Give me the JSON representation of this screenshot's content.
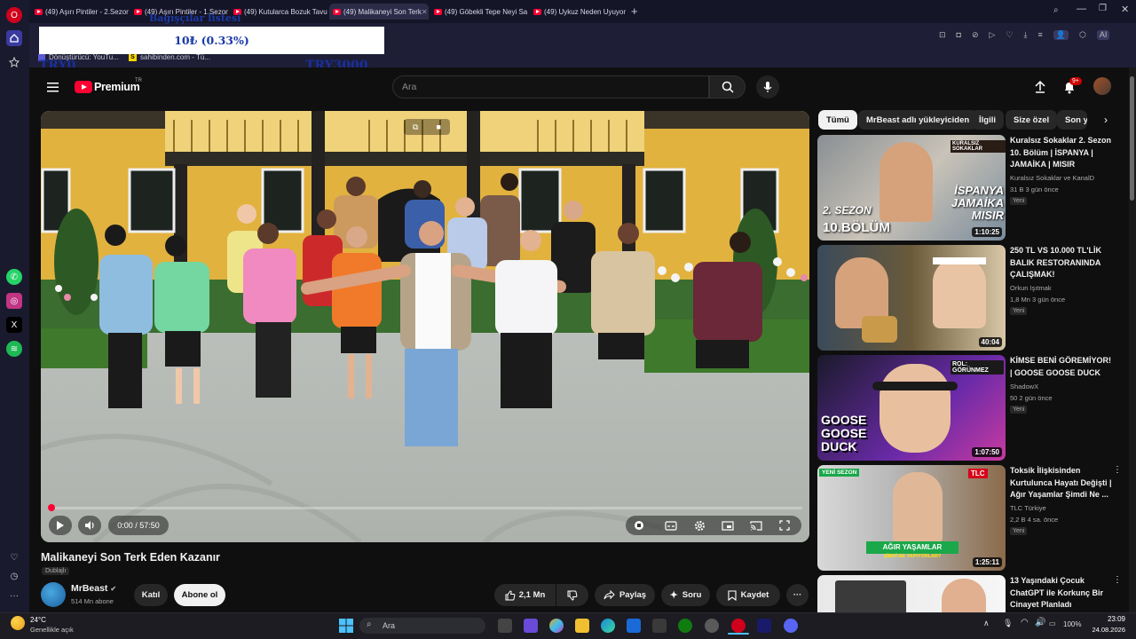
{
  "browser": {
    "tabs": [
      {
        "label": "(49) Aşırı Pintiler - 2.Sezon"
      },
      {
        "label": "(49) Aşırı Pintiler - 1.Sezon"
      },
      {
        "label": "(49) Kutularca Bozuk Tavuk"
      },
      {
        "label": "(49) Malikaneyi Son Terk"
      },
      {
        "label": "(49) Göbekli Tepe Neyi Sa"
      },
      {
        "label": "(49) Uykuz Neden Uyuyor"
      }
    ],
    "bookmarks": [
      {
        "label": "Dönüştürücü: YouTu..."
      },
      {
        "label": "sahibinden.com - Tü..."
      }
    ],
    "overlay": {
      "price": "10₺ (0.33%)",
      "top_text": "Bağışçılar listesi",
      "left_label": "TRY0",
      "right_label": "TRY3000"
    }
  },
  "youtube": {
    "logo": "Premium",
    "logo_sup": "TR",
    "search_placeholder": "Ara",
    "notif_count": "9+",
    "player": {
      "time": "0:00 / 57:50",
      "progress": 0.0
    },
    "video": {
      "title": "Malikaneyi Son Terk Eden Kazanır",
      "dub_label": "Dublajlı",
      "channel": "MrBeast",
      "subs": "514 Mn abone",
      "join": "Katıl",
      "subscribe": "Abone ol",
      "likes": "2,1 Mn",
      "share": "Paylaş",
      "ask": "Soru",
      "save": "Kaydet"
    },
    "chips": [
      "Tümü",
      "MrBeast adlı yükleyiciden",
      "İlgili",
      "Size özel",
      "Son y"
    ],
    "related": [
      {
        "title": "Kuralsız Sokaklar 2. Sezon 10. Bölüm | İSPANYA | JAMAİKA | MISIR",
        "channel": "Kuralsız Sokaklar ve KanalD",
        "meta": "31 B  3 gün önce",
        "badge": "Yeni",
        "duration": "1:10:25",
        "thumb_text1": "2. SEZON",
        "thumb_text2": "10.BÖLÜM",
        "thumb_text3": "İSPANYA JAMAİKA MISIR",
        "thumb_text4": "KURALSIZ SOKAKLAR"
      },
      {
        "title": "250 TL VS 10.000 TL'LİK BALIK RESTORANINDA ÇALIŞMAK!",
        "channel": "Orkun Işıtmak",
        "meta": "1,8 Mn  3 gün önce",
        "badge": "Yeni",
        "duration": "40:04"
      },
      {
        "title": "KİMSE BENİ GÖREMİYOR! | GOOSE GOOSE DUCK",
        "channel": "ShadowX",
        "meta": "50  2 gün önce",
        "badge": "Yeni",
        "duration": "1:07:50",
        "thumb_text1": "GOOSE GOOSE DUCK",
        "thumb_text2": "ROL: GÖRÜNMEZ"
      },
      {
        "title": "Toksik İlişkisinden Kurtulunca Hayatı Değişti | Ağır Yaşamlar Şimdi Ne ...",
        "channel": "TLC Türkiye",
        "meta": "2,2 B  4 sa. önce",
        "badge": "Yeni",
        "duration": "1:25:11",
        "thumb_text1": "YENİ SEZON",
        "thumb_text2": "AĞIR YAŞAMLAR",
        "thumb_text3": "ŞİMDİ NE YAPIYORLAR?",
        "thumb_text4": "TLC"
      },
      {
        "title": "13 Yaşındaki Çocuk ChatGPT ile Korkunç Bir Cinayet Planladı",
        "channel": "",
        "meta": "",
        "badge": "",
        "duration": ""
      }
    ]
  },
  "taskbar": {
    "weather_temp": "24°C",
    "weather_desc": "Genellikle açık",
    "search": "Ara",
    "battery": "100%",
    "time": "23:09",
    "date": "24.08.2026"
  },
  "colors": {
    "yt_red": "#ff0033",
    "bg": "#0f0f0f",
    "chip": "#272727",
    "sky_sidebar": "#1a1a2e"
  }
}
